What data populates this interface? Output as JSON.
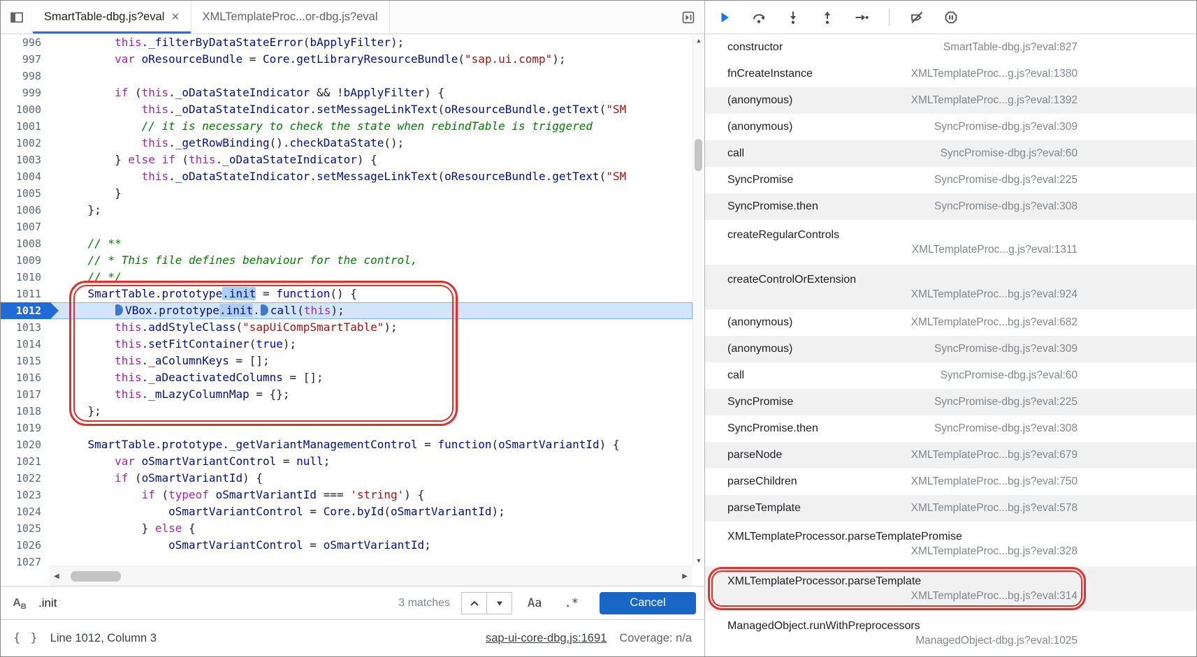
{
  "tabs": {
    "items": [
      {
        "label": "SmartTable-dbg.js?eval",
        "active": true,
        "closable": true
      },
      {
        "label": "XMLTemplateProc...or-dbg.js?eval",
        "active": false
      }
    ]
  },
  "editor": {
    "active_line": 1012,
    "lines": [
      {
        "n": 996,
        "tokens": [
          [
            "p",
            "        "
          ],
          [
            "k",
            "this"
          ],
          [
            "p",
            "."
          ],
          [
            "v",
            "_filterByDataStateError"
          ],
          [
            "p",
            "("
          ],
          [
            "v",
            "bApplyFilter"
          ],
          [
            "p",
            ");"
          ]
        ]
      },
      {
        "n": 997,
        "tokens": [
          [
            "p",
            "        "
          ],
          [
            "k",
            "var"
          ],
          [
            "p",
            " "
          ],
          [
            "v",
            "oResourceBundle"
          ],
          [
            "p",
            " = "
          ],
          [
            "v",
            "Core"
          ],
          [
            "p",
            "."
          ],
          [
            "v",
            "getLibraryResourceBundle"
          ],
          [
            "p",
            "("
          ],
          [
            "s",
            "\"sap.ui.comp\""
          ],
          [
            "p",
            ");"
          ]
        ]
      },
      {
        "n": 998,
        "tokens": []
      },
      {
        "n": 999,
        "tokens": [
          [
            "p",
            "        "
          ],
          [
            "k",
            "if"
          ],
          [
            "p",
            " ("
          ],
          [
            "k",
            "this"
          ],
          [
            "p",
            "."
          ],
          [
            "v",
            "_oDataStateIndicator"
          ],
          [
            "p",
            " && !"
          ],
          [
            "v",
            "bApplyFilter"
          ],
          [
            "p",
            ") {"
          ]
        ]
      },
      {
        "n": 1000,
        "tokens": [
          [
            "p",
            "            "
          ],
          [
            "k",
            "this"
          ],
          [
            "p",
            "."
          ],
          [
            "v",
            "_oDataStateIndicator"
          ],
          [
            "p",
            "."
          ],
          [
            "v",
            "setMessageLinkText"
          ],
          [
            "p",
            "("
          ],
          [
            "v",
            "oResourceBundle"
          ],
          [
            "p",
            "."
          ],
          [
            "v",
            "getText"
          ],
          [
            "p",
            "("
          ],
          [
            "s",
            "\"SM"
          ]
        ]
      },
      {
        "n": 1001,
        "tokens": [
          [
            "p",
            "            "
          ],
          [
            "c",
            "// it is necessary to check the state when rebindTable is triggered"
          ]
        ]
      },
      {
        "n": 1002,
        "tokens": [
          [
            "p",
            "            "
          ],
          [
            "k",
            "this"
          ],
          [
            "p",
            "."
          ],
          [
            "v",
            "_getRowBinding"
          ],
          [
            "p",
            "()."
          ],
          [
            "v",
            "checkDataState"
          ],
          [
            "p",
            "();"
          ]
        ]
      },
      {
        "n": 1003,
        "tokens": [
          [
            "p",
            "        } "
          ],
          [
            "k",
            "else"
          ],
          [
            "p",
            " "
          ],
          [
            "k",
            "if"
          ],
          [
            "p",
            " ("
          ],
          [
            "k",
            "this"
          ],
          [
            "p",
            "."
          ],
          [
            "v",
            "_oDataStateIndicator"
          ],
          [
            "p",
            ") {"
          ]
        ]
      },
      {
        "n": 1004,
        "tokens": [
          [
            "p",
            "            "
          ],
          [
            "k",
            "this"
          ],
          [
            "p",
            "."
          ],
          [
            "v",
            "_oDataStateIndicator"
          ],
          [
            "p",
            "."
          ],
          [
            "v",
            "setMessageLinkText"
          ],
          [
            "p",
            "("
          ],
          [
            "v",
            "oResourceBundle"
          ],
          [
            "p",
            "."
          ],
          [
            "v",
            "getText"
          ],
          [
            "p",
            "("
          ],
          [
            "s",
            "\"SM"
          ]
        ]
      },
      {
        "n": 1005,
        "tokens": [
          [
            "p",
            "        }"
          ]
        ]
      },
      {
        "n": 1006,
        "tokens": [
          [
            "p",
            "    };"
          ]
        ]
      },
      {
        "n": 1007,
        "tokens": []
      },
      {
        "n": 1008,
        "tokens": [
          [
            "p",
            "    "
          ],
          [
            "c",
            "// **"
          ]
        ]
      },
      {
        "n": 1009,
        "tokens": [
          [
            "p",
            "    "
          ],
          [
            "c",
            "// * This file defines behaviour for the control,"
          ]
        ]
      },
      {
        "n": 1010,
        "tokens": [
          [
            "p",
            "    "
          ],
          [
            "c",
            "// */"
          ]
        ]
      },
      {
        "n": 1011,
        "tokens": [
          [
            "p",
            "    "
          ],
          [
            "v",
            "SmartTable"
          ],
          [
            "p",
            "."
          ],
          [
            "v",
            "prototype"
          ],
          [
            "match",
            ".init"
          ],
          [
            "p",
            " = "
          ],
          [
            "b",
            "function"
          ],
          [
            "p",
            "() {"
          ]
        ]
      },
      {
        "n": 1012,
        "tokens": [
          [
            "p",
            "        "
          ],
          [
            "ibp",
            ""
          ],
          [
            "v",
            "VBox"
          ],
          [
            "p",
            "."
          ],
          [
            "v",
            "prototype"
          ],
          [
            "match",
            ".init"
          ],
          [
            "p",
            "."
          ],
          [
            "ibp",
            ""
          ],
          [
            "v",
            "call"
          ],
          [
            "p",
            "("
          ],
          [
            "k",
            "this"
          ],
          [
            "p",
            ");"
          ]
        ]
      },
      {
        "n": 1013,
        "tokens": [
          [
            "p",
            "        "
          ],
          [
            "k",
            "this"
          ],
          [
            "p",
            "."
          ],
          [
            "v",
            "addStyleClass"
          ],
          [
            "p",
            "("
          ],
          [
            "s",
            "\"sapUiCompSmartTable\""
          ],
          [
            "p",
            ");"
          ]
        ]
      },
      {
        "n": 1014,
        "tokens": [
          [
            "p",
            "        "
          ],
          [
            "k",
            "this"
          ],
          [
            "p",
            "."
          ],
          [
            "v",
            "setFitContainer"
          ],
          [
            "p",
            "("
          ],
          [
            "b",
            "true"
          ],
          [
            "p",
            ");"
          ]
        ]
      },
      {
        "n": 1015,
        "tokens": [
          [
            "p",
            "        "
          ],
          [
            "k",
            "this"
          ],
          [
            "p",
            "."
          ],
          [
            "v",
            "_aColumnKeys"
          ],
          [
            "p",
            " = [];"
          ]
        ]
      },
      {
        "n": 1016,
        "tokens": [
          [
            "p",
            "        "
          ],
          [
            "k",
            "this"
          ],
          [
            "p",
            "."
          ],
          [
            "v",
            "_aDeactivatedColumns"
          ],
          [
            "p",
            " = [];"
          ]
        ]
      },
      {
        "n": 1017,
        "tokens": [
          [
            "p",
            "        "
          ],
          [
            "k",
            "this"
          ],
          [
            "p",
            "."
          ],
          [
            "v",
            "_mLazyColumnMap"
          ],
          [
            "p",
            " = {};"
          ]
        ]
      },
      {
        "n": 1018,
        "tokens": [
          [
            "p",
            "    };"
          ]
        ]
      },
      {
        "n": 1019,
        "tokens": []
      },
      {
        "n": 1020,
        "tokens": [
          [
            "p",
            "    "
          ],
          [
            "v",
            "SmartTable"
          ],
          [
            "p",
            "."
          ],
          [
            "v",
            "prototype"
          ],
          [
            "p",
            "."
          ],
          [
            "v",
            "_getVariantManagementControl"
          ],
          [
            "p",
            " = "
          ],
          [
            "b",
            "function"
          ],
          [
            "p",
            "("
          ],
          [
            "v",
            "oSmartVariantId"
          ],
          [
            "p",
            ") {"
          ]
        ]
      },
      {
        "n": 1021,
        "tokens": [
          [
            "p",
            "        "
          ],
          [
            "k",
            "var"
          ],
          [
            "p",
            " "
          ],
          [
            "v",
            "oSmartVariantControl"
          ],
          [
            "p",
            " = "
          ],
          [
            "b",
            "null"
          ],
          [
            "p",
            ";"
          ]
        ]
      },
      {
        "n": 1022,
        "tokens": [
          [
            "p",
            "        "
          ],
          [
            "k",
            "if"
          ],
          [
            "p",
            " ("
          ],
          [
            "v",
            "oSmartVariantId"
          ],
          [
            "p",
            ") {"
          ]
        ]
      },
      {
        "n": 1023,
        "tokens": [
          [
            "p",
            "            "
          ],
          [
            "k",
            "if"
          ],
          [
            "p",
            " ("
          ],
          [
            "k",
            "typeof"
          ],
          [
            "p",
            " "
          ],
          [
            "v",
            "oSmartVariantId"
          ],
          [
            "p",
            " === "
          ],
          [
            "s",
            "'string'"
          ],
          [
            "p",
            ") {"
          ]
        ]
      },
      {
        "n": 1024,
        "tokens": [
          [
            "p",
            "                "
          ],
          [
            "v",
            "oSmartVariantControl"
          ],
          [
            "p",
            " = "
          ],
          [
            "v",
            "Core"
          ],
          [
            "p",
            "."
          ],
          [
            "v",
            "byId"
          ],
          [
            "p",
            "("
          ],
          [
            "v",
            "oSmartVariantId"
          ],
          [
            "p",
            ");"
          ]
        ]
      },
      {
        "n": 1025,
        "tokens": [
          [
            "p",
            "            } "
          ],
          [
            "k",
            "else"
          ],
          [
            "p",
            " {"
          ]
        ]
      },
      {
        "n": 1026,
        "tokens": [
          [
            "p",
            "                "
          ],
          [
            "v",
            "oSmartVariantControl"
          ],
          [
            "p",
            " = "
          ],
          [
            "v",
            "oSmartVariantId"
          ],
          [
            "p",
            ";"
          ]
        ]
      },
      {
        "n": 1027,
        "tokens": []
      }
    ]
  },
  "find_bar": {
    "query": ".init",
    "matches_label": "3 matches",
    "match_case_label": "Aa",
    "regex_label": ".*",
    "cancel_label": "Cancel"
  },
  "status_bar": {
    "line_info": "Line 1012, Column 3",
    "source_link": "sap-ui-core-dbg.js:1691",
    "coverage": "Coverage: n/a"
  },
  "debugger_toolbar": {
    "buttons": [
      "resume",
      "step-over",
      "step-into",
      "step-out",
      "step",
      "deactivate-breakpoints",
      "pause-on-exceptions"
    ],
    "resume_color": "#1a73e8"
  },
  "call_stack": {
    "frames": [
      {
        "name": "constructor",
        "location": "SmartTable-dbg.js?eval:827"
      },
      {
        "name": "fnCreateInstance",
        "location": "XMLTemplateProc...g.js?eval:1380"
      },
      {
        "name": "(anonymous)",
        "location": "XMLTemplateProc...g.js?eval:1392"
      },
      {
        "name": "(anonymous)",
        "location": "SyncPromise-dbg.js?eval:309"
      },
      {
        "name": "call",
        "location": "SyncPromise-dbg.js?eval:60"
      },
      {
        "name": "SyncPromise",
        "location": "SyncPromise-dbg.js?eval:225"
      },
      {
        "name": "SyncPromise.then",
        "location": "SyncPromise-dbg.js?eval:308"
      },
      {
        "name": "createRegularControls",
        "location": "XMLTemplateProc...g.js?eval:1311",
        "wrap": true
      },
      {
        "name": "createControlOrExtension",
        "location": "XMLTemplateProc...bg.js?eval:924",
        "wrap": true
      },
      {
        "name": "(anonymous)",
        "location": "XMLTemplateProc...bg.js?eval:682"
      },
      {
        "name": "(anonymous)",
        "location": "SyncPromise-dbg.js?eval:309"
      },
      {
        "name": "call",
        "location": "SyncPromise-dbg.js?eval:60"
      },
      {
        "name": "SyncPromise",
        "location": "SyncPromise-dbg.js?eval:225"
      },
      {
        "name": "SyncPromise.then",
        "location": "SyncPromise-dbg.js?eval:308"
      },
      {
        "name": "parseNode",
        "location": "XMLTemplateProc...bg.js?eval:679"
      },
      {
        "name": "parseChildren",
        "location": "XMLTemplateProc...bg.js?eval:750"
      },
      {
        "name": "parseTemplate",
        "location": "XMLTemplateProc...bg.js?eval:578"
      },
      {
        "name": "XMLTemplateProcessor.parseTemplatePromise",
        "location": "XMLTemplateProc...bg.js?eval:328",
        "wrap": true
      },
      {
        "name": "XMLTemplateProcessor.parseTemplate",
        "location": "XMLTemplateProc...bg.js?eval:314",
        "wrap": true,
        "circled": true
      },
      {
        "name": "ManagedObject.runWithPreprocessors",
        "location": "ManagedObject-dbg.js?eval:1025",
        "wrap": true
      }
    ]
  },
  "annotations": {
    "code_circle": "lines 1011-1018",
    "stack_circle": "XMLTemplateProcessor.parseTemplate",
    "color": "#e0312d"
  },
  "colors": {
    "accent": "#1a73e8",
    "current_line_bg": "#d3e4fb",
    "keyword": "#a626a4",
    "function_keyword": "#0000e6",
    "string": "#a31515",
    "comment": "#007a00",
    "identifier": "#001080"
  }
}
